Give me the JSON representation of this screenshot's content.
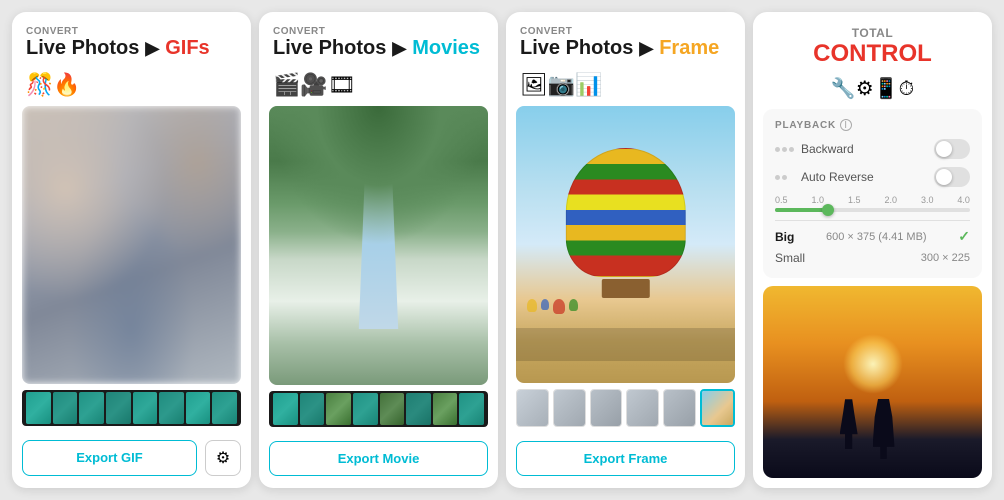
{
  "panels": [
    {
      "id": "gif-panel",
      "convert_label": "CONVERT",
      "title_live": "Live Photos",
      "arrow": "▶",
      "title_type": "GIFs",
      "title_type_color": "#e8342a",
      "icons": "🎊🔥",
      "export_button": "Export GIF",
      "gear_icon": "⚙",
      "image_type": "blur",
      "filmstrip_type": "teal"
    },
    {
      "id": "movie-panel",
      "convert_label": "CONVERT",
      "title_live": "Live Photos",
      "arrow": "▶",
      "title_type": "Movies",
      "title_type_color": "#00bcd4",
      "icons": "🎬🎥🎞",
      "export_button": "Export Movie",
      "image_type": "garden",
      "filmstrip_type": "garden"
    },
    {
      "id": "frame-panel",
      "convert_label": "CONVERT",
      "title_live": "Live Photos",
      "arrow": "▶",
      "title_type": "Frame",
      "title_type_color": "#f5a623",
      "icons": "🖼📷📊",
      "export_button": "Export Frame",
      "image_type": "balloon",
      "filmstrip_type": "frames"
    },
    {
      "id": "control-panel",
      "total_label": "TOTAL",
      "title_type": "CONTROL",
      "title_type_color": "#e8342a",
      "icons": "🔧⚙📱⏱",
      "settings": {
        "section_title": "PLAYBACK",
        "backward_label": "Backward",
        "auto_reverse_label": "Auto Reverse",
        "slider_labels": [
          "0.5",
          "1.0",
          "1.5",
          "2.0",
          "3.0",
          "4.0"
        ],
        "size_big_label": "Big",
        "size_big_dims": "600 × 375 (4.41 MB)",
        "size_small_label": "Small",
        "size_small_dims": "300 × 225"
      },
      "image_type": "silhouette"
    }
  ]
}
